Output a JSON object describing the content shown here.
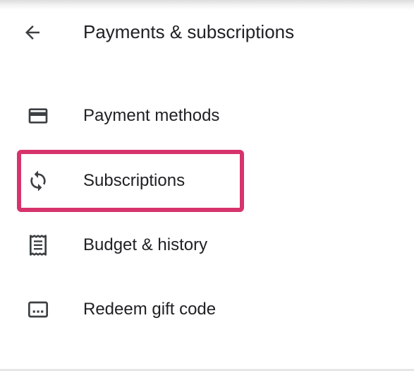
{
  "header": {
    "back_icon": "arrow-back-icon",
    "title": "Payments & subscriptions"
  },
  "menu": {
    "items": [
      {
        "id": "payment-methods",
        "icon": "credit-card-icon",
        "label": "Payment methods"
      },
      {
        "id": "subscriptions",
        "icon": "sync-icon",
        "label": "Subscriptions",
        "highlighted": true
      },
      {
        "id": "budget-history",
        "icon": "receipt-icon",
        "label": "Budget & history"
      },
      {
        "id": "redeem-gift-code",
        "icon": "gift-code-icon",
        "label": "Redeem gift code"
      }
    ]
  },
  "colors": {
    "text": "#202124",
    "icon": "#3c4043",
    "highlight": "#d6336c",
    "background": "#ffffff"
  }
}
